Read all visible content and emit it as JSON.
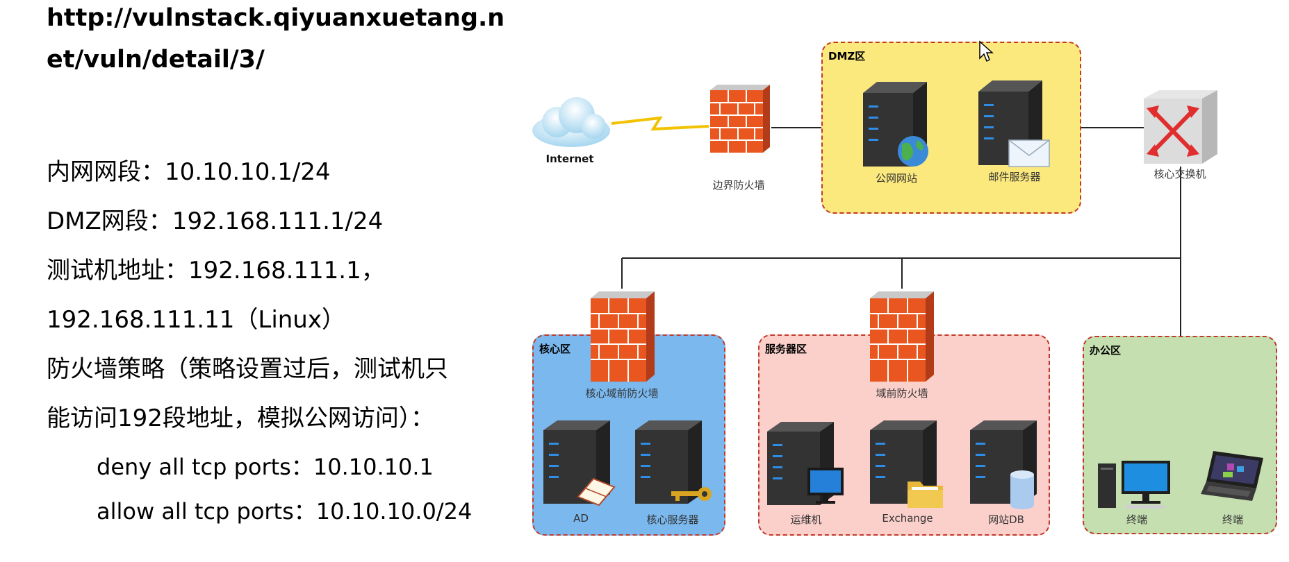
{
  "url": {
    "line1": "http://vulnstack.qiyuanxuetang.n",
    "line2": "et/vuln/detail/3/"
  },
  "info": {
    "intranet": "内网网段：10.10.10.1/24",
    "dmz": "DMZ网段：192.168.111.1/24",
    "tester1": "测试机地址：192.168.111.1，",
    "tester2": "192.168.111.11（Linux）",
    "policy1": "防火墙策略（策略设置过后，测试机只",
    "policy2": "能访问192段地址，模拟公网访问）：",
    "rule1": "deny all tcp ports：10.10.10.1",
    "rule2": "allow all tcp ports：10.10.10.0/24"
  },
  "diagram": {
    "internet": "Internet",
    "border_firewall": "边界防火墙",
    "core_switch": "核心交换机",
    "zones": {
      "dmz": {
        "title": "DMZ区",
        "color": "#fbe97e",
        "nodes": [
          "公网网站",
          "邮件服务器"
        ]
      },
      "core": {
        "title": "核心区",
        "color": "#7ab8ee",
        "firewall": "核心域前防火墙",
        "nodes": [
          "AD",
          "核心服务器"
        ]
      },
      "server": {
        "title": "服务器区",
        "color": "#fbd0cb",
        "firewall": "域前防火墙",
        "nodes": [
          "运维机",
          "Exchange",
          "网站DB"
        ]
      },
      "office": {
        "title": "办公区",
        "color": "#c5dfb0",
        "nodes": [
          "终端",
          "终端"
        ]
      }
    },
    "border_color": "#c0392b"
  }
}
